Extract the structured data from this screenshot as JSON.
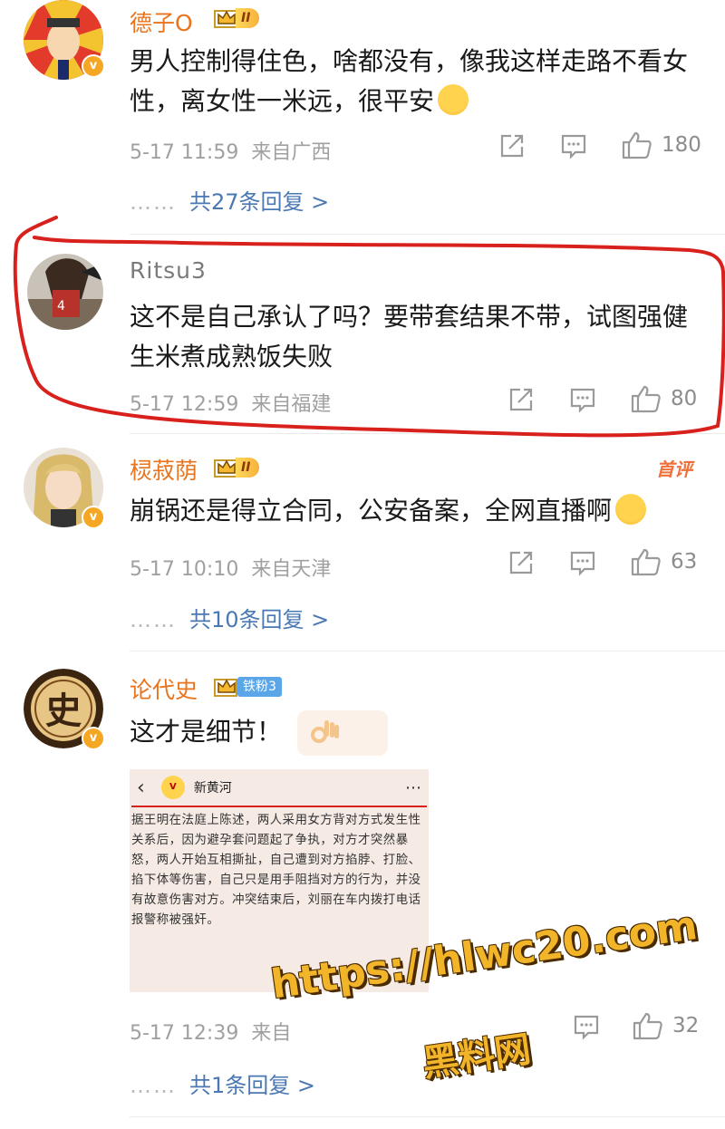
{
  "comments": [
    {
      "username": "德子O",
      "rank_label": "II",
      "text": "男人控制得住色，啥都没有，像我这样走路不看女性，离女性一米远，很平安",
      "time": "5-17 11:59",
      "location": "来自广西",
      "likes": "180",
      "replies": "共27条回复 >"
    },
    {
      "username": "Ritsu3",
      "text": "这不是自己承认了吗？要带套结果不带，试图强健生米煮成熟饭失败",
      "time": "5-17 12:59",
      "location": "来自福建",
      "likes": "80"
    },
    {
      "username": "棂菽荫",
      "rank_label": "II",
      "hot_label": "首评",
      "text": "崩锅还是得立合同，公安备案，全网直播啊",
      "time": "5-17 10:10",
      "location": "来自天津",
      "likes": "63",
      "replies": "共10条回复 >"
    },
    {
      "username": "论代史",
      "fan_label": "铁粉3",
      "text": "这才是细节！",
      "time": "5-17 12:39",
      "location": "来自",
      "likes": "32",
      "replies": "共1条回复 >",
      "quote": {
        "account": "新黄河",
        "avatar_text": "V",
        "text": "据王明在法庭上陈述，两人采用女方背对方式发生性关系后，因为避孕套问题起了争执，对方才突然暴怒，两人开始互相撕扯，自己遭到对方掐脖、打脸、掐下体等伤害，自己只是用手阻挡对方的行为，并没有故意伤害对方。冲突结束后，刘丽在车内拨打电话报警称被强奸。"
      }
    }
  ],
  "ellipsis": "……",
  "watermark": {
    "url": "https://hlwc20.com",
    "site": "黑料网"
  },
  "colors": {
    "username": "#e8741e",
    "link": "#4a78b3",
    "annotation": "#d8201c",
    "watermark": "#f2b428"
  },
  "icons": [
    "share-icon",
    "comment-icon",
    "like-icon",
    "crown-icon",
    "verified-icon",
    "back-icon",
    "more-icon"
  ]
}
